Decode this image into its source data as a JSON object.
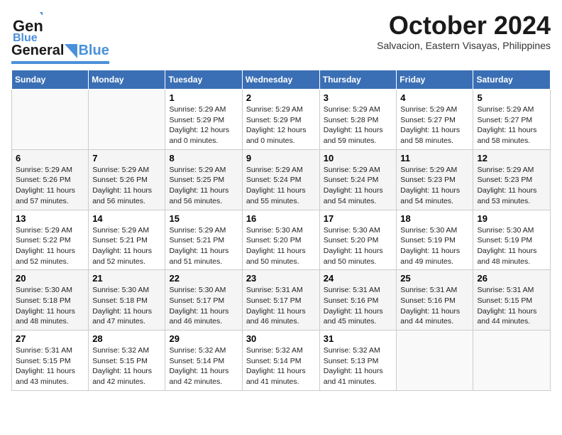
{
  "logo": {
    "part1": "General",
    "part2": "Blue"
  },
  "title": "October 2024",
  "subtitle": "Salvacion, Eastern Visayas, Philippines",
  "days_header": [
    "Sunday",
    "Monday",
    "Tuesday",
    "Wednesday",
    "Thursday",
    "Friday",
    "Saturday"
  ],
  "weeks": [
    [
      {
        "day": "",
        "info": ""
      },
      {
        "day": "",
        "info": ""
      },
      {
        "day": "1",
        "info": "Sunrise: 5:29 AM\nSunset: 5:29 PM\nDaylight: 12 hours\nand 0 minutes."
      },
      {
        "day": "2",
        "info": "Sunrise: 5:29 AM\nSunset: 5:29 PM\nDaylight: 12 hours\nand 0 minutes."
      },
      {
        "day": "3",
        "info": "Sunrise: 5:29 AM\nSunset: 5:28 PM\nDaylight: 11 hours\nand 59 minutes."
      },
      {
        "day": "4",
        "info": "Sunrise: 5:29 AM\nSunset: 5:27 PM\nDaylight: 11 hours\nand 58 minutes."
      },
      {
        "day": "5",
        "info": "Sunrise: 5:29 AM\nSunset: 5:27 PM\nDaylight: 11 hours\nand 58 minutes."
      }
    ],
    [
      {
        "day": "6",
        "info": "Sunrise: 5:29 AM\nSunset: 5:26 PM\nDaylight: 11 hours\nand 57 minutes."
      },
      {
        "day": "7",
        "info": "Sunrise: 5:29 AM\nSunset: 5:26 PM\nDaylight: 11 hours\nand 56 minutes."
      },
      {
        "day": "8",
        "info": "Sunrise: 5:29 AM\nSunset: 5:25 PM\nDaylight: 11 hours\nand 56 minutes."
      },
      {
        "day": "9",
        "info": "Sunrise: 5:29 AM\nSunset: 5:24 PM\nDaylight: 11 hours\nand 55 minutes."
      },
      {
        "day": "10",
        "info": "Sunrise: 5:29 AM\nSunset: 5:24 PM\nDaylight: 11 hours\nand 54 minutes."
      },
      {
        "day": "11",
        "info": "Sunrise: 5:29 AM\nSunset: 5:23 PM\nDaylight: 11 hours\nand 54 minutes."
      },
      {
        "day": "12",
        "info": "Sunrise: 5:29 AM\nSunset: 5:23 PM\nDaylight: 11 hours\nand 53 minutes."
      }
    ],
    [
      {
        "day": "13",
        "info": "Sunrise: 5:29 AM\nSunset: 5:22 PM\nDaylight: 11 hours\nand 52 minutes."
      },
      {
        "day": "14",
        "info": "Sunrise: 5:29 AM\nSunset: 5:21 PM\nDaylight: 11 hours\nand 52 minutes."
      },
      {
        "day": "15",
        "info": "Sunrise: 5:29 AM\nSunset: 5:21 PM\nDaylight: 11 hours\nand 51 minutes."
      },
      {
        "day": "16",
        "info": "Sunrise: 5:30 AM\nSunset: 5:20 PM\nDaylight: 11 hours\nand 50 minutes."
      },
      {
        "day": "17",
        "info": "Sunrise: 5:30 AM\nSunset: 5:20 PM\nDaylight: 11 hours\nand 50 minutes."
      },
      {
        "day": "18",
        "info": "Sunrise: 5:30 AM\nSunset: 5:19 PM\nDaylight: 11 hours\nand 49 minutes."
      },
      {
        "day": "19",
        "info": "Sunrise: 5:30 AM\nSunset: 5:19 PM\nDaylight: 11 hours\nand 48 minutes."
      }
    ],
    [
      {
        "day": "20",
        "info": "Sunrise: 5:30 AM\nSunset: 5:18 PM\nDaylight: 11 hours\nand 48 minutes."
      },
      {
        "day": "21",
        "info": "Sunrise: 5:30 AM\nSunset: 5:18 PM\nDaylight: 11 hours\nand 47 minutes."
      },
      {
        "day": "22",
        "info": "Sunrise: 5:30 AM\nSunset: 5:17 PM\nDaylight: 11 hours\nand 46 minutes."
      },
      {
        "day": "23",
        "info": "Sunrise: 5:31 AM\nSunset: 5:17 PM\nDaylight: 11 hours\nand 46 minutes."
      },
      {
        "day": "24",
        "info": "Sunrise: 5:31 AM\nSunset: 5:16 PM\nDaylight: 11 hours\nand 45 minutes."
      },
      {
        "day": "25",
        "info": "Sunrise: 5:31 AM\nSunset: 5:16 PM\nDaylight: 11 hours\nand 44 minutes."
      },
      {
        "day": "26",
        "info": "Sunrise: 5:31 AM\nSunset: 5:15 PM\nDaylight: 11 hours\nand 44 minutes."
      }
    ],
    [
      {
        "day": "27",
        "info": "Sunrise: 5:31 AM\nSunset: 5:15 PM\nDaylight: 11 hours\nand 43 minutes."
      },
      {
        "day": "28",
        "info": "Sunrise: 5:32 AM\nSunset: 5:15 PM\nDaylight: 11 hours\nand 42 minutes."
      },
      {
        "day": "29",
        "info": "Sunrise: 5:32 AM\nSunset: 5:14 PM\nDaylight: 11 hours\nand 42 minutes."
      },
      {
        "day": "30",
        "info": "Sunrise: 5:32 AM\nSunset: 5:14 PM\nDaylight: 11 hours\nand 41 minutes."
      },
      {
        "day": "31",
        "info": "Sunrise: 5:32 AM\nSunset: 5:13 PM\nDaylight: 11 hours\nand 41 minutes."
      },
      {
        "day": "",
        "info": ""
      },
      {
        "day": "",
        "info": ""
      }
    ]
  ]
}
